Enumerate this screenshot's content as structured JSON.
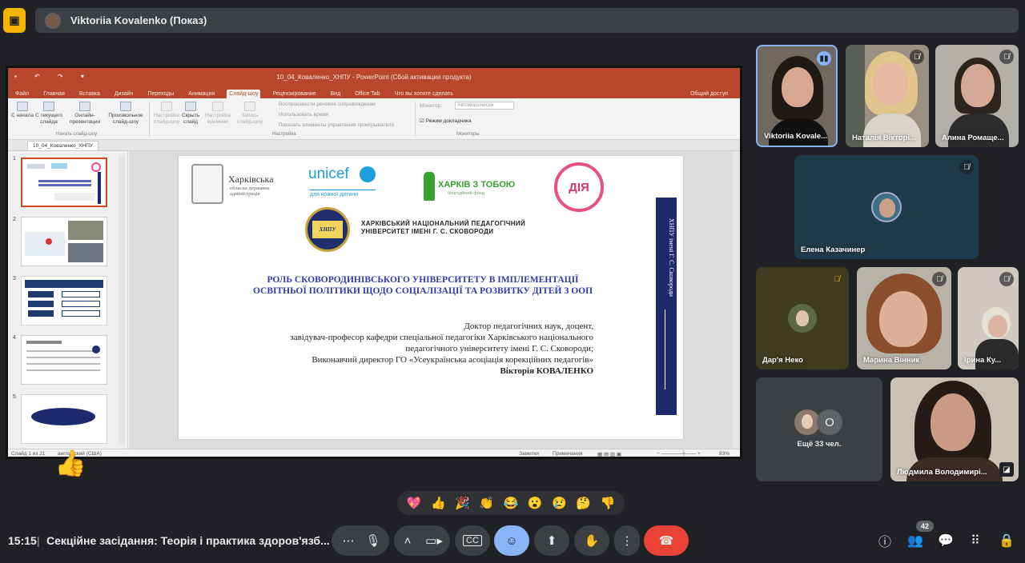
{
  "presenter_bar": {
    "presenter_label": "Viktoriia Kovalenko (Показ)"
  },
  "powerpoint": {
    "window_title": "10_04_Коваленко_ХНПУ - PowerPoint (Сбой активации продукта)",
    "tabs": [
      "Файл",
      "Главная",
      "Вставка",
      "Дизайн",
      "Переходы",
      "Анимация",
      "Слайд-шоу",
      "Рецензирование",
      "Вид",
      "Office Tab",
      "Что вы хотите сделать"
    ],
    "active_tab": "Слайд-шоу",
    "share": "Общий доступ",
    "ribbon": {
      "from_start": "С начала",
      "from_current": "С текущего слайда",
      "online": "Онлайн-презентация",
      "custom": "Произвольное слайд-шоу",
      "group_start": "Начать слайд-шоу",
      "setup": "Настройка слайд-шоу",
      "hide": "Скрыть слайд",
      "rehearse": "Настройка времени",
      "record": "Запись слайд-шоу",
      "opt1": "Воспроизвести речевое сопровождение",
      "opt2": "Использовать время",
      "opt3": "Показать элементы управления проигрывателя",
      "group_setup": "Настройка",
      "monitor_label": "Монитор:",
      "monitor_value": "Автоматически",
      "presenter_view": "Режим докладчика",
      "group_monitors": "Мониторы"
    },
    "doc_tab": "10_04_Коваленко_ХНПУ",
    "thumb_numbers": [
      "1",
      "2",
      "3",
      "4",
      "5"
    ],
    "status": {
      "slide": "Слайд 1 из 21",
      "lang": "английский (США)",
      "notes": "Заметки",
      "comments": "Примечания",
      "zoom": "83%"
    }
  },
  "slide": {
    "obl_name": "Харківська",
    "obl_sub": "обласна державна адміністрація",
    "unicef": "unicef",
    "unicef_sub": "для кожної дитини",
    "kharkiv": "ХАРКІВ З ТОБОЮ",
    "kharkiv_sub": "благодійний фонд",
    "diya": "ДІЯ",
    "seal_text": "ХНПУ",
    "seal_year": "1804",
    "university": "ХАРКІВСЬКИЙ НАЦІОНАЛЬНИЙ ПЕДАГОГІЧНИЙ\nУНІВЕРСИТЕТ ІМЕНІ Г. С. СКОВОРОДИ",
    "title": "РОЛЬ СКОВОРОДИНІВСЬКОГО УНІВЕРСИТЕТУ В ІМПЛЕМЕНТАЦІЇ\nОСВІТНЬОЇ ПОЛІТИКИ ЩОДО СОЦІАЛІЗАЦІЇ ТА РОЗВИТКУ ДІТЕЙ З ООП",
    "author_lines": "Доктор педагогічних наук, доцент,\nзавідувач-професор кафедри спеціальної педагогіки Харківського національного\nпедагогічного університету імені Г. С. Сковороди;\nВиконавчий директор ГО «Усеукраїнська асоціація корекційних педагогів»",
    "author_name": "Вікторія КОВАЛЕНКО",
    "side_banner": "ХНПУ імені Г. С. Сковороди"
  },
  "participants": [
    {
      "name": "Viktoriia Kovale...",
      "state": "speaking"
    },
    {
      "name": "Наталія Вікторі...",
      "state": "muted"
    },
    {
      "name": "Алина Ромаще...",
      "state": "muted"
    },
    {
      "name": "Елена Казачинер",
      "state": "muted"
    },
    {
      "name": "Дар'я Неко",
      "state": "muted"
    },
    {
      "name": "Марина Вінник",
      "state": "muted"
    },
    {
      "name": "Ірина Ку...",
      "state": "muted"
    },
    {
      "name": "Ещё 33 чел.",
      "state": "others",
      "badge": "О"
    },
    {
      "name": "Людмила Володимирі...",
      "state": "unmuted"
    }
  ],
  "emoji_reactions": [
    "💖",
    "👍",
    "🎉",
    "👏",
    "😂",
    "😮",
    "😢",
    "🤔",
    "👎"
  ],
  "floating_reaction": "👍",
  "bottom": {
    "time": "15:15",
    "meeting_title": "Секційне засідання: Теорія і практика здоров'язб...",
    "participant_count": "42"
  },
  "colors": {
    "background": "#202124",
    "accent_yellow": "#f4b400",
    "end_call_red": "#ea4335",
    "reaction_active": "#8ab4f8",
    "powerpoint_red": "#b7472a"
  }
}
